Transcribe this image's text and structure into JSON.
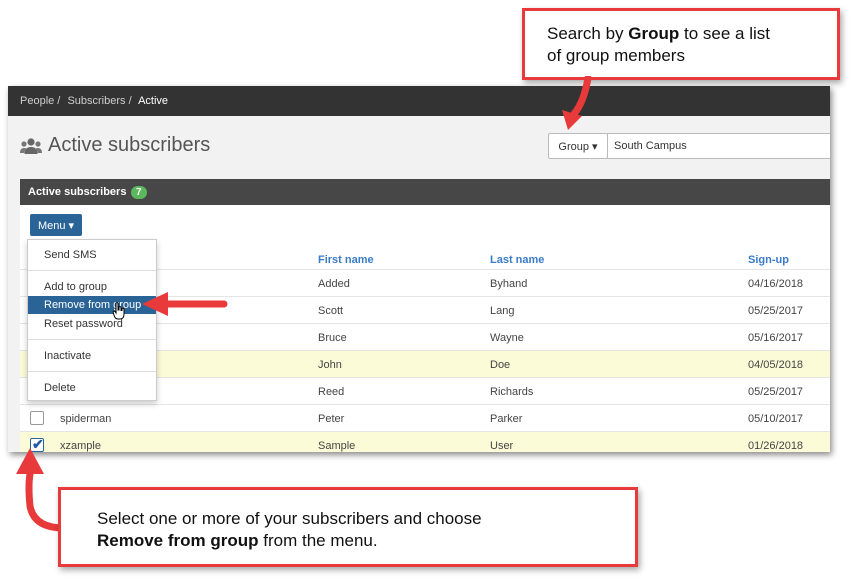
{
  "breadcrumb": {
    "items": [
      "People /",
      "Subscribers /"
    ],
    "current": "Active"
  },
  "page": {
    "title": "Active subscribers"
  },
  "search": {
    "group_button": "Group ▾",
    "value": "South Campus"
  },
  "panel": {
    "title": "Active subscribers",
    "count": "7"
  },
  "menu": {
    "button": "Menu ▾"
  },
  "dropdown": {
    "items": [
      "Send SMS",
      "Add to group",
      "Remove from group",
      "Reset password",
      "Inactivate",
      "Delete"
    ]
  },
  "table": {
    "headers": {
      "first_name": "First name",
      "last_name": "Last name",
      "signup": "Sign-up"
    },
    "rows": [
      {
        "username": "",
        "first": "Added",
        "last": "Byhand",
        "signup": "04/16/2018",
        "highlight": false,
        "checked": false
      },
      {
        "username": "",
        "first": "Scott",
        "last": "Lang",
        "signup": "05/25/2017",
        "highlight": false,
        "checked": false
      },
      {
        "username": "",
        "first": "Bruce",
        "last": "Wayne",
        "signup": "05/16/2017",
        "highlight": false,
        "checked": false
      },
      {
        "username": "",
        "first": "John",
        "last": "Doe",
        "signup": "04/05/2018",
        "highlight": true,
        "checked": false
      },
      {
        "username": "",
        "first": "Reed",
        "last": "Richards",
        "signup": "05/25/2017",
        "highlight": false,
        "checked": false
      },
      {
        "username": "spiderman",
        "first": "Peter",
        "last": "Parker",
        "signup": "05/10/2017",
        "highlight": false,
        "checked": false
      },
      {
        "username": "xzample",
        "first": "Sample",
        "last": "User",
        "signup": "01/26/2018",
        "highlight": true,
        "checked": true
      }
    ]
  },
  "callouts": {
    "top": {
      "line1_pre": "Search by ",
      "line1_bold": "Group",
      "line1_post": " to see a list",
      "line2": "of group members"
    },
    "bottom": {
      "line1": "Select one or more of your subscribers and choose",
      "line2_bold": "Remove from group",
      "line2_post": " from the menu."
    }
  },
  "colors": {
    "callout_border": "#e83a3a",
    "menu_blue": "#2a6496",
    "highlight_row": "#fcfbd7",
    "badge_green": "#5cb85c"
  }
}
